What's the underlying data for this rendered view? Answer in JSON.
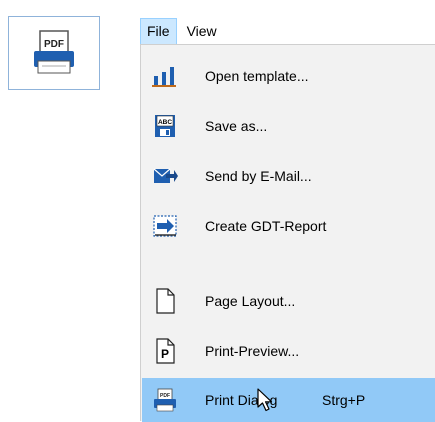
{
  "toolbar": {
    "print_pdf_button": {
      "icon": "pdf-printer-icon",
      "badge": "PDF"
    }
  },
  "menubar": {
    "items": [
      {
        "label": "File",
        "active": true
      },
      {
        "label": "View",
        "active": false
      }
    ]
  },
  "file_menu": {
    "items": [
      {
        "label": "Open template...",
        "icon": "bar-chart-icon"
      },
      {
        "label": "Save as...",
        "icon": "floppy-disk-abc-icon"
      },
      {
        "label": "Send by E-Mail...",
        "icon": "envelope-arrow-icon"
      },
      {
        "label": "Create GDT-Report",
        "icon": "gdt-report-icon"
      },
      {
        "label": "Page Layout...",
        "icon": "page-icon"
      },
      {
        "label": "Print-Preview...",
        "icon": "print-preview-icon",
        "icon_text": "P"
      },
      {
        "label": "Print Dialog",
        "icon": "pdf-printer-icon",
        "icon_text": "PDF",
        "shortcut": "Strg+P",
        "highlighted": true
      }
    ]
  },
  "colors": {
    "menu_bg": "#f2f2f2",
    "highlight": "#91c9f7",
    "menubar_active": "#cce8ff",
    "accent_blue": "#1f5fb0"
  }
}
